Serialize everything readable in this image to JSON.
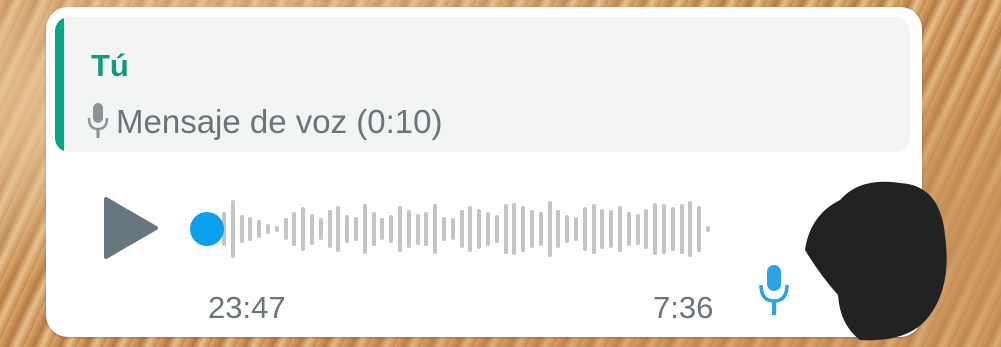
{
  "message": {
    "quoted_reply": {
      "author": "Tú",
      "text": "Mensaje de voz (0:10)",
      "icon": "mic-icon",
      "accent_color": "#06a884"
    },
    "voice_note": {
      "duration": "23:47",
      "timestamp": "7:36",
      "play_icon": "play-icon",
      "status_icon": "mic-icon",
      "progress": 0,
      "accent_color": "#0aa0ee",
      "waveform_levels": [
        0.55,
        0.95,
        0.45,
        0.4,
        0.3,
        0.15,
        0.1,
        0.35,
        0.55,
        0.7,
        0.5,
        0.35,
        0.6,
        0.75,
        0.45,
        0.4,
        0.8,
        0.55,
        0.35,
        0.45,
        0.75,
        0.6,
        0.5,
        0.55,
        0.8,
        0.4,
        0.35,
        0.6,
        0.75,
        0.65,
        0.55,
        0.45,
        0.8,
        0.85,
        0.75,
        0.6,
        0.55,
        0.9,
        0.6,
        0.45,
        0.4,
        0.7,
        0.8,
        0.65,
        0.6,
        0.75,
        0.55,
        0.5,
        0.65,
        0.85,
        0.8,
        0.7,
        0.8,
        0.9,
        0.75,
        0.1
      ]
    }
  }
}
